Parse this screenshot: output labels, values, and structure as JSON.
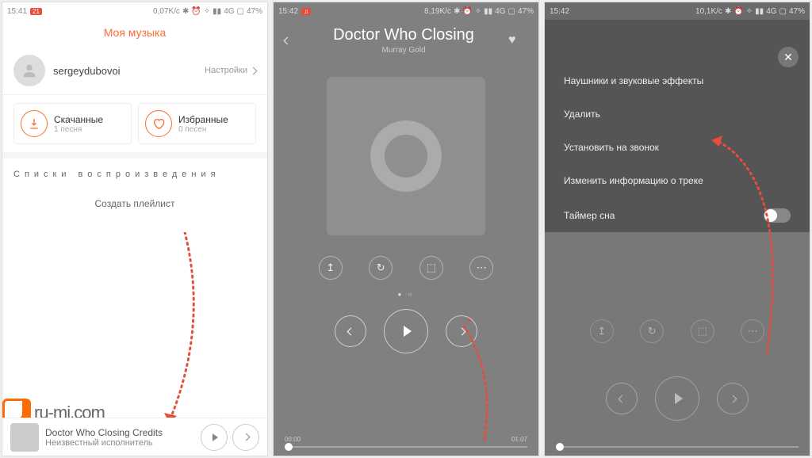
{
  "status": {
    "time1": "15:41",
    "net1": "0,07K/c",
    "sig": "4G",
    "batt": "47%",
    "time2": "15:42",
    "net2": "8,19K/c",
    "time3": "15:42",
    "net3": "10,1K/c"
  },
  "p1": {
    "title": "Моя музыка",
    "username": "sergeydubovoi",
    "settings": "Настройки",
    "downloaded": {
      "title": "Скачанные",
      "sub": "1 песня"
    },
    "favorites": {
      "title": "Избранные",
      "sub": "0 песен"
    },
    "playlists_header": "Списки воспроизведения",
    "create_playlist": "Создать плейлист",
    "now_track": "Doctor Who Closing Credits",
    "now_artist": "Неизвестный исполнитель"
  },
  "p2": {
    "title": "Doctor Who Closing",
    "artist": "Murray Gold",
    "time_cur": "00:00",
    "time_tot": "01:07"
  },
  "p3": {
    "items": [
      "Наушники и звуковые эффекты",
      "Удалить",
      "Установить на звонок",
      "Изменить информацию о треке",
      "Таймер сна"
    ]
  },
  "watermark": "ru-mi.com"
}
